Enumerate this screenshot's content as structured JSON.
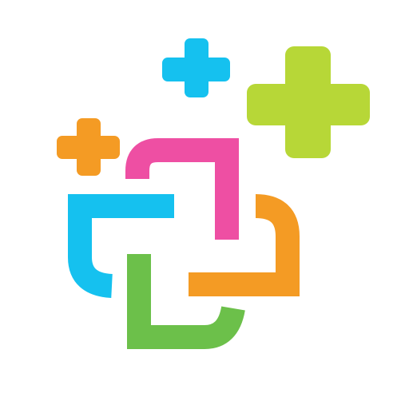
{
  "logo": {
    "icon": "interlocking-brackets-with-plus-signs",
    "colors": {
      "background": "#ffffff",
      "blue": "#15c1ef",
      "pink": "#ee4fa3",
      "orange": "#f49b24",
      "green": "#6cc04a",
      "lime": "#b7d737"
    }
  }
}
